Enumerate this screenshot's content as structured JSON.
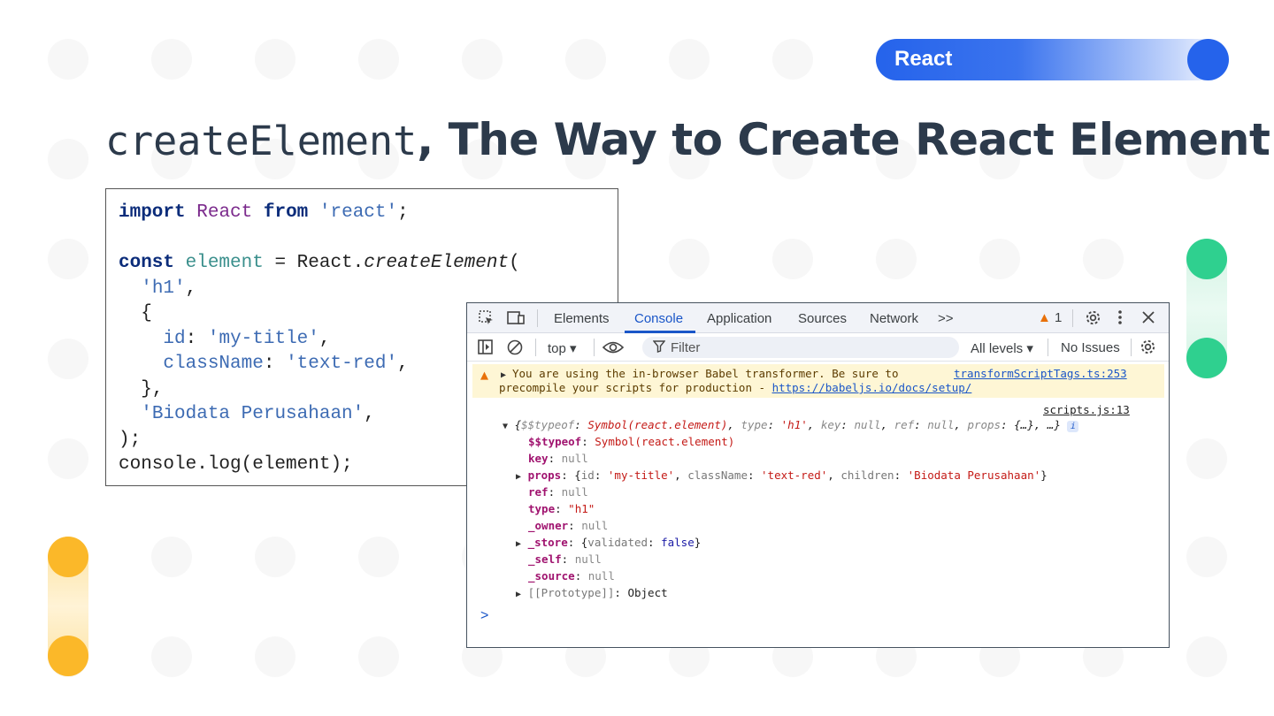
{
  "tag": {
    "label": "React"
  },
  "title": {
    "code": "createElement",
    "text": ", The Way to Create React Element"
  },
  "code": {
    "import_kw": "import",
    "import_ident": "React",
    "from_kw": "from",
    "import_str": "'react'",
    "semicolon": ";",
    "const_kw": "const",
    "var_name": "element",
    "assign": " = React.",
    "fn_name": "createElement",
    "open_paren": "(",
    "arg1": "'h1'",
    "comma": ",",
    "brace_open": "{",
    "prop_id": "id",
    "val_id": "'my-title'",
    "prop_class": "className",
    "val_class": "'text-red'",
    "brace_close": "},",
    "arg3": "'Biodata Perusahaan'",
    "close_paren": ");",
    "log_line": "console.log(element);"
  },
  "devtools": {
    "tabs": [
      "Elements",
      "Console",
      "Application",
      "Sources",
      "Network"
    ],
    "more_tabs": ">>",
    "warning_count": "1",
    "context": "top",
    "filter_placeholder": "Filter",
    "levels": "All levels",
    "issues": "No Issues",
    "warning": {
      "line1": "You are using the in-browser Babel transformer. Be sure to",
      "line2": "precompile your scripts for production - ",
      "url": "https://babeljs.io/docs/setup/",
      "source": "transformScriptTags.ts:253"
    },
    "log_source": "scripts.js:13",
    "object": {
      "summary_key1": "$$typeof",
      "summary_val1": "Symbol(react.element)",
      "summary_key2": "type",
      "summary_val2": "'h1'",
      "summary_key3": "key",
      "summary_key4": "ref",
      "summary_key5": "props",
      "summary_props": "{…}",
      "summary_more": "…",
      "null": "null",
      "typeof_key": "$$typeof",
      "typeof_val": "Symbol(react.element)",
      "key_key": "key",
      "props_key": "props",
      "props_id_key": "id",
      "props_id_val": "'my-title'",
      "props_class_key": "className",
      "props_class_val": "'text-red'",
      "props_children_key": "children",
      "props_children_val": "'Biodata Perusahaan'",
      "ref_key": "ref",
      "type_key": "type",
      "type_val": "\"h1\"",
      "owner_key": "_owner",
      "store_key": "_store",
      "store_validated_key": "validated",
      "store_validated_val": "false",
      "self_key": "_self",
      "source_key": "_source",
      "prototype_key": "[[Prototype]]",
      "prototype_val": "Object"
    },
    "prompt": ">"
  }
}
